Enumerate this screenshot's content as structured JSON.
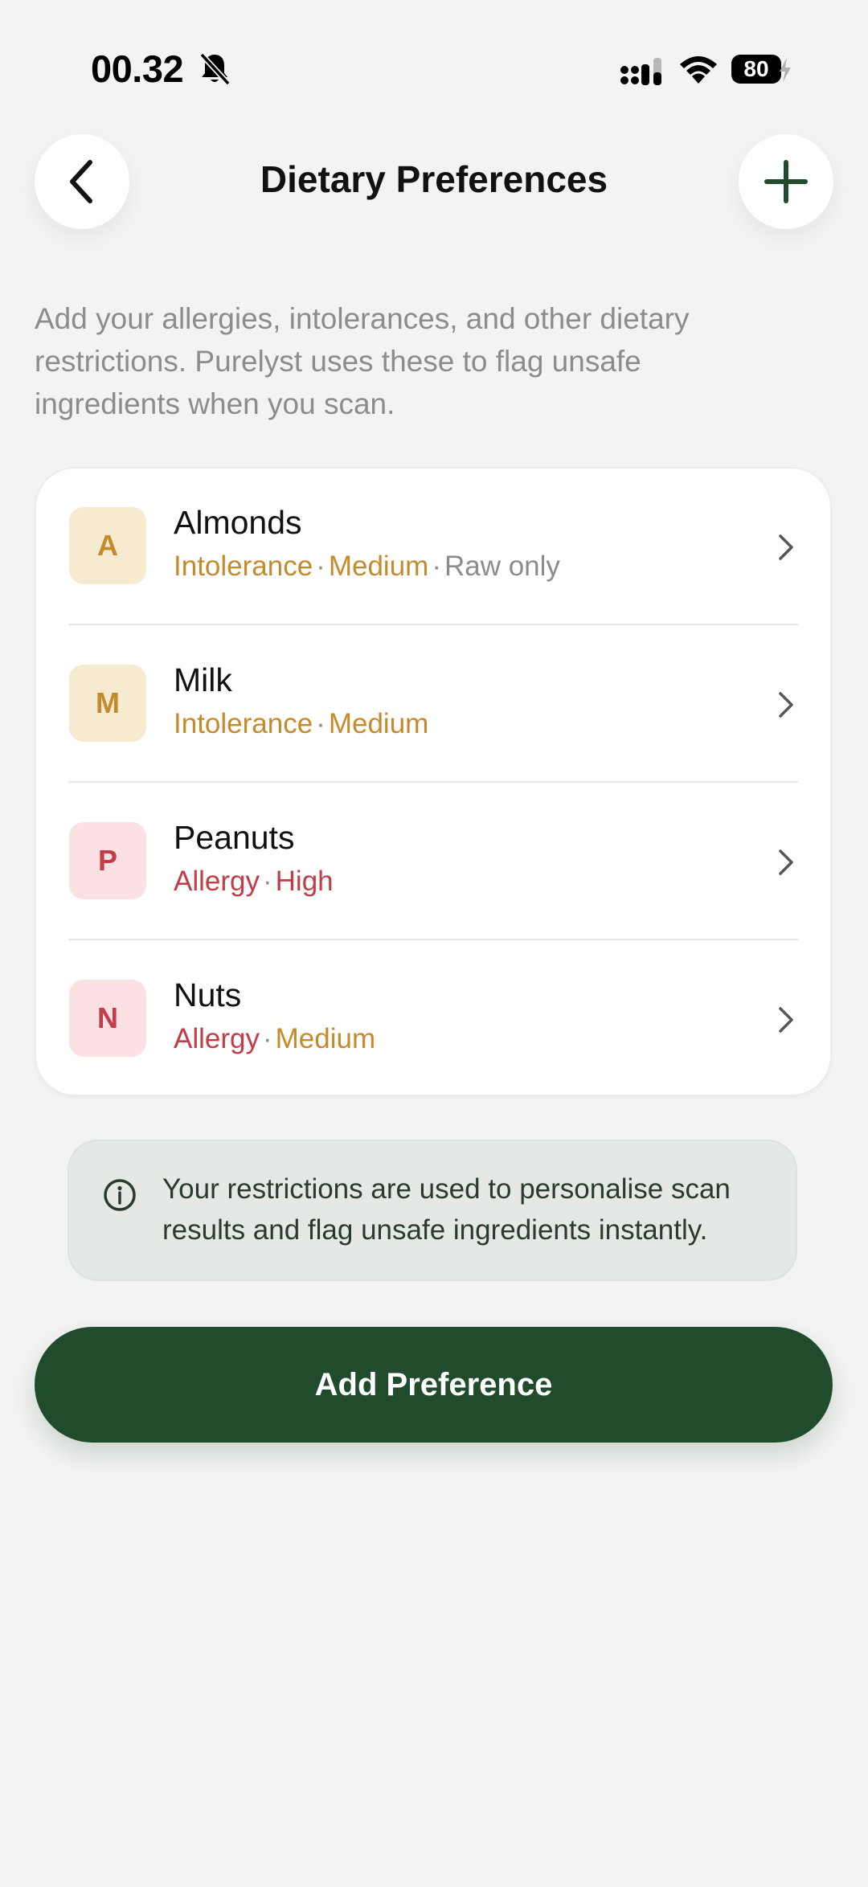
{
  "status_bar": {
    "time": "00.32",
    "battery": "80",
    "icons": [
      "bell-slash-icon",
      "signal-icon",
      "wifi-icon",
      "battery-icon",
      "charging-bolt-icon"
    ]
  },
  "header": {
    "title": "Dietary Preferences",
    "back_icon": "chevron-left-icon",
    "add_icon": "plus-icon"
  },
  "description": "Add your allergies, intolerances, and other dietary restrictions. Purelyst uses these to flag unsafe ingredients when you scan.",
  "preferences": [
    {
      "initial": "A",
      "name": "Almonds",
      "type": "Intolerance",
      "severity": "Medium",
      "note": "Raw only",
      "badge_color": "#f6ead0"
    },
    {
      "initial": "M",
      "name": "Milk",
      "type": "Intolerance",
      "severity": "Medium",
      "badge_color": "#f6ead0"
    },
    {
      "initial": "P",
      "name": "Peanuts",
      "type": "Allergy",
      "severity": "High",
      "badge_color": "#fbe0e4"
    },
    {
      "initial": "N",
      "name": "Nuts",
      "type": "Allergy",
      "severity": "Medium",
      "badge_color": "#fbe0e4"
    }
  ],
  "info": {
    "icon": "info-circle-icon",
    "text": "Your restrictions are used to personalise scan results and flag unsafe ingredients instantly."
  },
  "primary_button": {
    "label": "Add Preference"
  },
  "colors": {
    "background": "#f3f3f2",
    "primary": "#214b2d",
    "intolerance": "#c58a2c",
    "allergy": "#c43c47",
    "muted": "#8c8c8c"
  }
}
